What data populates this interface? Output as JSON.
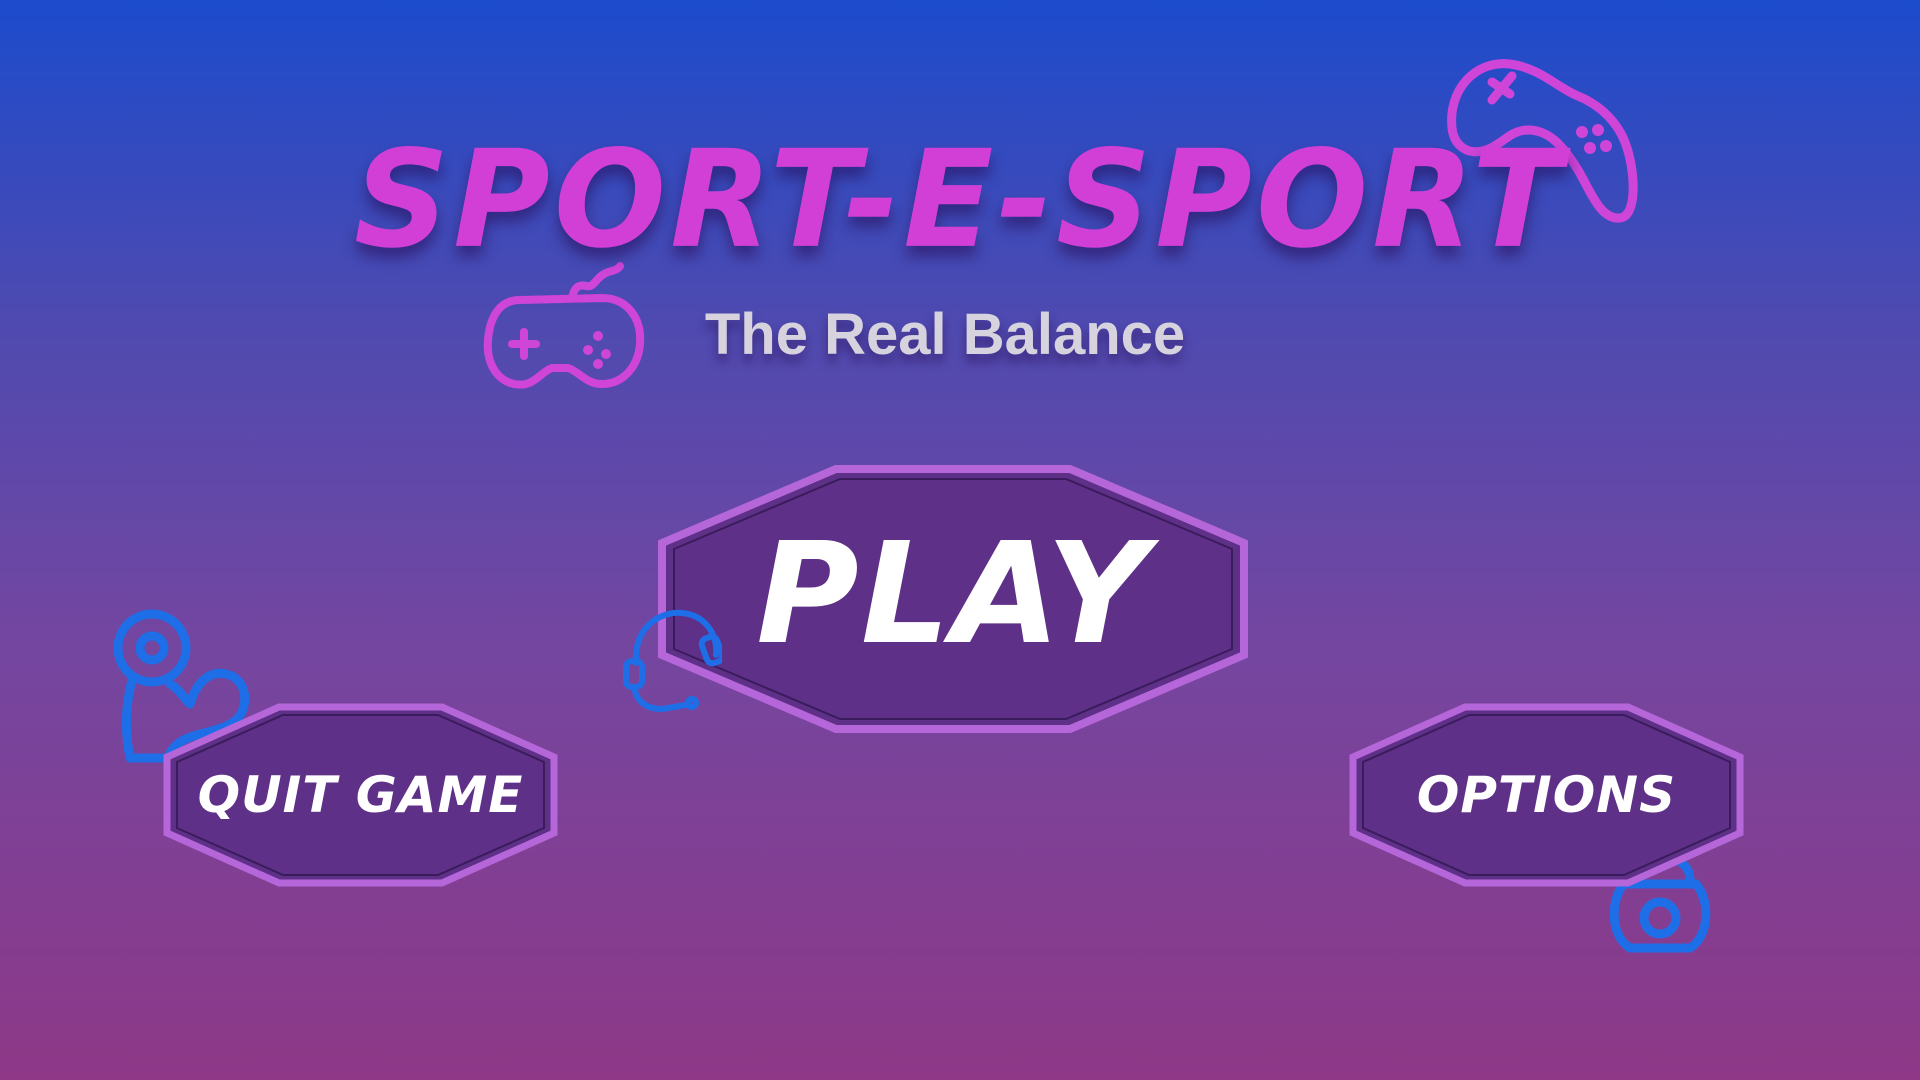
{
  "title": "SPORT-E-SPORT",
  "subtitle": "The Real Balance",
  "menu": {
    "play_label": "PLAY",
    "quit_label": "QUIT GAME",
    "options_label": "OPTIONS"
  },
  "colors": {
    "title": "#d13fd6",
    "subtitle": "#d6d3df",
    "button_fill": "#5e3087",
    "button_border": "#b566d9",
    "icon_pink": "#cf45d8",
    "icon_blue": "#1e6ee8"
  },
  "icons": {
    "controllers": "gamepad-icon",
    "headset": "headset-icon",
    "muscle": "flexed-arm-icon",
    "kettlebell": "kettlebell-icon"
  }
}
